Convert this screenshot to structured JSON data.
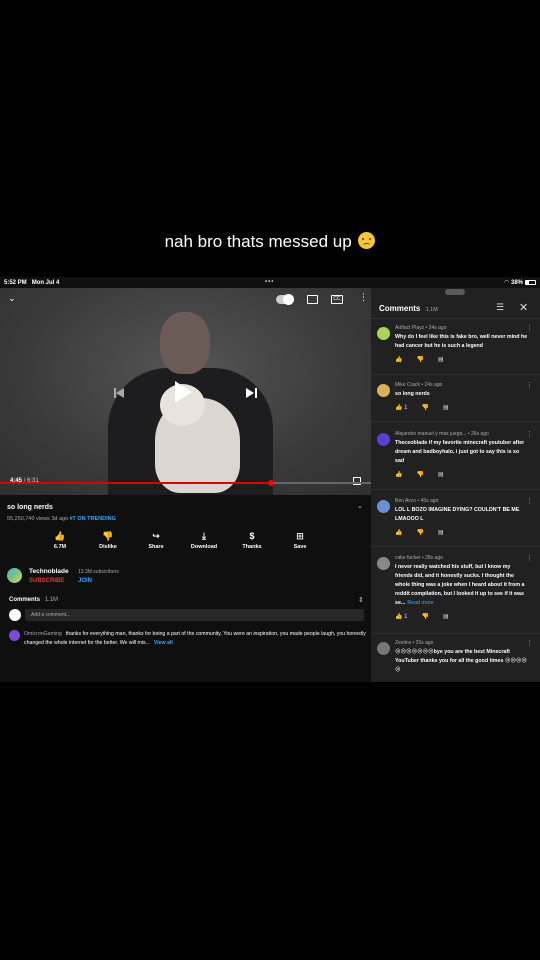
{
  "caption": {
    "text": "nah bro thats messed up",
    "emoji": "worried-face-emoji"
  },
  "status_bar": {
    "time": "5:52 PM",
    "date": "Mon Jul 4",
    "battery": "38%",
    "multitask": "•••"
  },
  "player": {
    "current_time": "4:45",
    "duration": "/ 6:31",
    "progress_fraction": 0.73,
    "icons": [
      "chevron-down-icon",
      "autoplay-toggle-icon",
      "cast-icon",
      "captions-icon",
      "more-icon",
      "play-icon",
      "previous-icon",
      "next-icon",
      "fullscreen-icon"
    ]
  },
  "video": {
    "title": "so long nerds",
    "views": "55,250,740 views",
    "age": "3d ago",
    "trending": "#7 ON TRENDING",
    "actions": [
      {
        "label": "6.7M",
        "icon": "like-icon",
        "glyph": "👍"
      },
      {
        "label": "Dislike",
        "icon": "dislike-icon",
        "glyph": "👎"
      },
      {
        "label": "Share",
        "icon": "share-icon",
        "glyph": "↪"
      },
      {
        "label": "Download",
        "icon": "download-icon",
        "glyph": "⤓"
      },
      {
        "label": "Thanks",
        "icon": "thanks-icon",
        "glyph": "$"
      },
      {
        "label": "Save",
        "icon": "save-icon",
        "glyph": "⊞"
      }
    ]
  },
  "channel": {
    "name": "Technoblade",
    "subscribers": "13.3M subscribers",
    "subscribe": "SUBSCRIBE",
    "join": "JOIN"
  },
  "comments_section": {
    "label": "Comments",
    "count": "1.1M",
    "placeholder": "Add a comment...",
    "top_comment": {
      "author": "OmicronGaming",
      "text": "thanks for everything man, thanks for being a part of the community. You were an inspiration, you made people laugh, you honestly changed the whole internet for the better. We will mis...",
      "view_all": "View all"
    }
  },
  "comments_panel": {
    "title": "Comments",
    "count": "1.1M",
    "comments": [
      {
        "author": "Artifact Playz • 24s ago",
        "text": "Why do I feel like this is fake bro, well never mind he had cancer but he is such a legend",
        "likes": "",
        "avatar_color": "#a8d65a"
      },
      {
        "author": "Mike Crack • 24s ago",
        "text": "so long nerds",
        "likes": "1",
        "avatar_color": "#d8b25a"
      },
      {
        "author": "Alejandro manuel y max juega... • 26s ago",
        "text": "Theceoblade if my favorite minecraft youtuber after dream and badboyhalo, i just got to say this is so sad",
        "likes": "",
        "avatar_color": "#5b3fd0"
      },
      {
        "author": "Ben Avco • 45s ago",
        "text": "LOL L BOZO IMAGINE DYING? COULDN'T BE ME LMAOOO L",
        "likes": "",
        "avatar_color": "#6a8fd8"
      },
      {
        "author": "cake fucker • 28s ago",
        "text": "I never really watched his stuff, but I know my friends did, and it honestly sucks. I thought the whole thing was a joke when I heard about it from a reddit compilation, but I looked it up to see if it was se...",
        "read_more": "Read more",
        "likes": "1",
        "avatar_color": "#888888"
      },
      {
        "author": "Zeelinx • 29s ago",
        "text": "😢😢😢😢😢😢😢bye you are the best Minecraft YouTuber thanks you for all the good times 😢😢😢😢😢",
        "likes": "",
        "avatar_color": "#777777"
      }
    ]
  }
}
